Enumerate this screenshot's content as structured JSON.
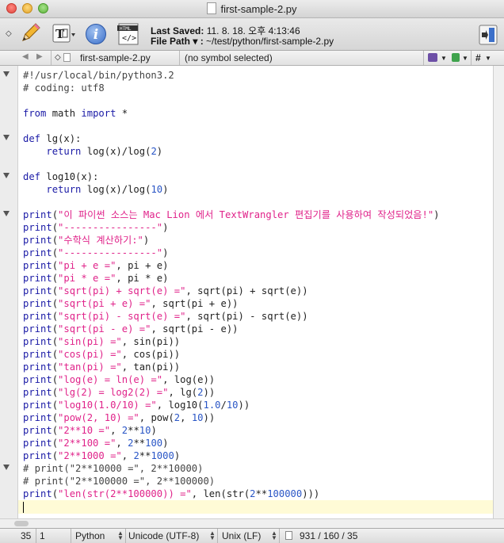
{
  "window": {
    "title": "first-sample-2.py"
  },
  "toolbar": {
    "saved_label": "Last Saved:",
    "saved_value": "11. 8. 18. 오후 4:13:46",
    "path_label": "File Path ▾ :",
    "path_value": "~/test/python/first-sample-2.py"
  },
  "navbar": {
    "file_name": "first-sample-2.py",
    "symbol": "(no symbol selected)",
    "hash": "#"
  },
  "editor": {
    "lines": [
      [
        [
          "c",
          "#!/usr/local/bin/python3.2"
        ]
      ],
      [
        [
          "c",
          "# coding: utf8"
        ]
      ],
      [],
      [
        [
          "k",
          "from"
        ],
        [
          "t",
          " math "
        ],
        [
          "k",
          "import"
        ],
        [
          "t",
          " *"
        ]
      ],
      [],
      [
        [
          "k",
          "def"
        ],
        [
          "t",
          " lg(x):"
        ]
      ],
      [
        [
          "t",
          "    "
        ],
        [
          "k",
          "return"
        ],
        [
          "t",
          " log(x)/log("
        ],
        [
          "n",
          "2"
        ],
        [
          "t",
          ")"
        ]
      ],
      [],
      [
        [
          "k",
          "def"
        ],
        [
          "t",
          " log10(x):"
        ]
      ],
      [
        [
          "t",
          "    "
        ],
        [
          "k",
          "return"
        ],
        [
          "t",
          " log(x)/log("
        ],
        [
          "n",
          "10"
        ],
        [
          "t",
          ")"
        ]
      ],
      [],
      [
        [
          "k",
          "print"
        ],
        [
          "t",
          "("
        ],
        [
          "s",
          "\"이 파이썬 소스는 Mac Lion 에서 TextWrangler 편집기를 사용하여 작성되었음!\""
        ],
        [
          "t",
          ")"
        ]
      ],
      [
        [
          "k",
          "print"
        ],
        [
          "t",
          "("
        ],
        [
          "s",
          "\"----------------\""
        ],
        [
          "t",
          ")"
        ]
      ],
      [
        [
          "k",
          "print"
        ],
        [
          "t",
          "("
        ],
        [
          "s",
          "\"수학식 계산하기:\""
        ],
        [
          "t",
          ")"
        ]
      ],
      [
        [
          "k",
          "print"
        ],
        [
          "t",
          "("
        ],
        [
          "s",
          "\"----------------\""
        ],
        [
          "t",
          ")"
        ]
      ],
      [
        [
          "k",
          "print"
        ],
        [
          "t",
          "("
        ],
        [
          "s",
          "\"pi + e =\""
        ],
        [
          "t",
          ", pi + e)"
        ]
      ],
      [
        [
          "k",
          "print"
        ],
        [
          "t",
          "("
        ],
        [
          "s",
          "\"pi * e =\""
        ],
        [
          "t",
          ", pi * e)"
        ]
      ],
      [
        [
          "k",
          "print"
        ],
        [
          "t",
          "("
        ],
        [
          "s",
          "\"sqrt(pi) + sqrt(e) =\""
        ],
        [
          "t",
          ", sqrt(pi) + sqrt(e))"
        ]
      ],
      [
        [
          "k",
          "print"
        ],
        [
          "t",
          "("
        ],
        [
          "s",
          "\"sqrt(pi + e) =\""
        ],
        [
          "t",
          ", sqrt(pi + e))"
        ]
      ],
      [
        [
          "k",
          "print"
        ],
        [
          "t",
          "("
        ],
        [
          "s",
          "\"sqrt(pi) - sqrt(e) =\""
        ],
        [
          "t",
          ", sqrt(pi) - sqrt(e))"
        ]
      ],
      [
        [
          "k",
          "print"
        ],
        [
          "t",
          "("
        ],
        [
          "s",
          "\"sqrt(pi - e) =\""
        ],
        [
          "t",
          ", sqrt(pi - e))"
        ]
      ],
      [
        [
          "k",
          "print"
        ],
        [
          "t",
          "("
        ],
        [
          "s",
          "\"sin(pi) =\""
        ],
        [
          "t",
          ", sin(pi))"
        ]
      ],
      [
        [
          "k",
          "print"
        ],
        [
          "t",
          "("
        ],
        [
          "s",
          "\"cos(pi) =\""
        ],
        [
          "t",
          ", cos(pi))"
        ]
      ],
      [
        [
          "k",
          "print"
        ],
        [
          "t",
          "("
        ],
        [
          "s",
          "\"tan(pi) =\""
        ],
        [
          "t",
          ", tan(pi))"
        ]
      ],
      [
        [
          "k",
          "print"
        ],
        [
          "t",
          "("
        ],
        [
          "s",
          "\"log(e) = ln(e) =\""
        ],
        [
          "t",
          ", log(e))"
        ]
      ],
      [
        [
          "k",
          "print"
        ],
        [
          "t",
          "("
        ],
        [
          "s",
          "\"lg(2) = log2(2) =\""
        ],
        [
          "t",
          ", lg("
        ],
        [
          "n",
          "2"
        ],
        [
          "t",
          "))"
        ]
      ],
      [
        [
          "k",
          "print"
        ],
        [
          "t",
          "("
        ],
        [
          "s",
          "\"log10(1.0/10) =\""
        ],
        [
          "t",
          ", log10("
        ],
        [
          "n",
          "1.0"
        ],
        [
          "t",
          "/"
        ],
        [
          "n",
          "10"
        ],
        [
          "t",
          "))"
        ]
      ],
      [
        [
          "k",
          "print"
        ],
        [
          "t",
          "("
        ],
        [
          "s",
          "\"pow(2, 10) =\""
        ],
        [
          "t",
          ", pow("
        ],
        [
          "n",
          "2"
        ],
        [
          "t",
          ", "
        ],
        [
          "n",
          "10"
        ],
        [
          "t",
          "))"
        ]
      ],
      [
        [
          "k",
          "print"
        ],
        [
          "t",
          "("
        ],
        [
          "s",
          "\"2**10 =\""
        ],
        [
          "t",
          ", "
        ],
        [
          "n",
          "2"
        ],
        [
          "t",
          "**"
        ],
        [
          "n",
          "10"
        ],
        [
          "t",
          ")"
        ]
      ],
      [
        [
          "k",
          "print"
        ],
        [
          "t",
          "("
        ],
        [
          "s",
          "\"2**100 =\""
        ],
        [
          "t",
          ", "
        ],
        [
          "n",
          "2"
        ],
        [
          "t",
          "**"
        ],
        [
          "n",
          "100"
        ],
        [
          "t",
          ")"
        ]
      ],
      [
        [
          "k",
          "print"
        ],
        [
          "t",
          "("
        ],
        [
          "s",
          "\"2**1000 =\""
        ],
        [
          "t",
          ", "
        ],
        [
          "n",
          "2"
        ],
        [
          "t",
          "**"
        ],
        [
          "n",
          "1000"
        ],
        [
          "t",
          ")"
        ]
      ],
      [
        [
          "c",
          "# print(\"2**10000 =\", 2**10000)"
        ]
      ],
      [
        [
          "c",
          "# print(\"2**100000 =\", 2**100000)"
        ]
      ],
      [
        [
          "k",
          "print"
        ],
        [
          "t",
          "("
        ],
        [
          "s",
          "\"len(str(2**100000)) =\""
        ],
        [
          "t",
          ", len(str("
        ],
        [
          "n",
          "2"
        ],
        [
          "t",
          "**"
        ],
        [
          "n",
          "100000"
        ],
        [
          "t",
          ")))"
        ]
      ],
      []
    ]
  },
  "status": {
    "line": "35",
    "column": "1",
    "language": "Python",
    "encoding": "Unicode (UTF-8)",
    "line_endings": "Unix (LF)",
    "counts": "931 / 160 / 35"
  },
  "colors": {
    "keyword": "#1a1aa6",
    "string": "#e0238a",
    "number": "#2a56c6",
    "current_line": "#fffbd6"
  }
}
